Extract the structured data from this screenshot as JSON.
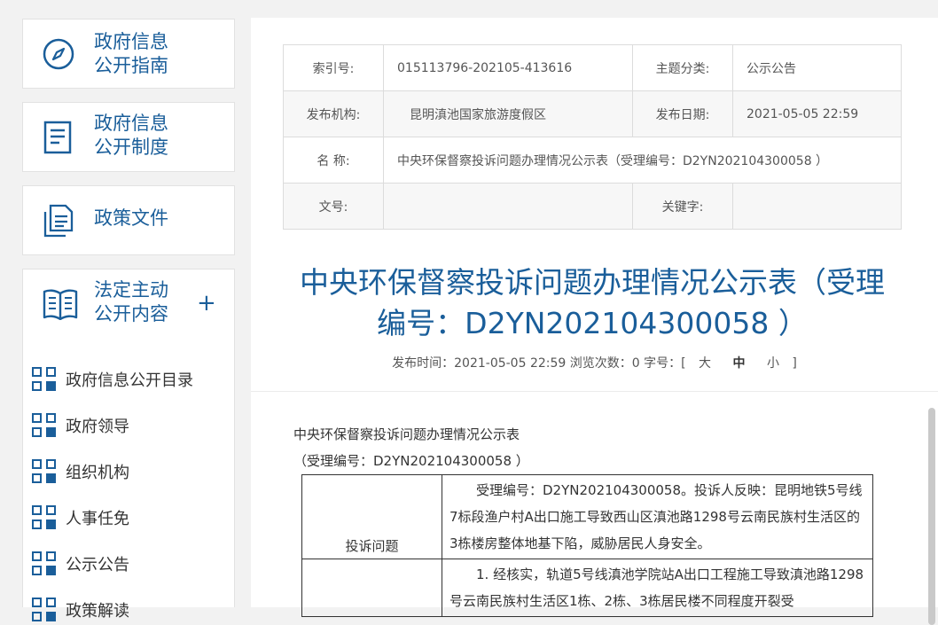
{
  "sidebar": {
    "boxes": [
      {
        "label": "政府信息\n公开指南",
        "icon": "compass-icon"
      },
      {
        "label": "政府信息\n公开制度",
        "icon": "document-icon"
      },
      {
        "label": "政策文件",
        "icon": "files-icon"
      },
      {
        "label": "法定主动\n公开内容",
        "icon": "open-book-icon",
        "expand": "+"
      }
    ],
    "subitems": [
      "政府信息公开目录",
      "政府领导",
      "组织机构",
      "人事任免",
      "公示公告",
      "政策解读"
    ]
  },
  "meta": {
    "index_label": "索引号:",
    "index_value": "015113796-202105-413616",
    "topic_label": "主题分类:",
    "topic_value": "公示公告",
    "org_label": "发布机构:",
    "org_value": "昆明滇池国家旅游度假区",
    "date_label": "发布日期:",
    "date_value": "2021-05-05 22:59",
    "name_label": "名 称:",
    "name_value": "中央环保督察投诉问题办理情况公示表（受理编号：D2YN202104300058 ）",
    "docno_label": "文号:",
    "docno_value": "",
    "keyword_label": "关键字:",
    "keyword_value": ""
  },
  "article": {
    "title": "中央环保督察投诉问题办理情况公示表（受理编号：D2YN202104300058 ）",
    "pub_time": "发布时间：2021-05-05 22:59 浏览次数：0 字号：[",
    "font_large": "大",
    "font_medium": "中",
    "font_small": "小",
    "bracket_close": "]",
    "line1": "中央环保督察投诉问题办理情况公示表",
    "line2": "（受理编号：D2YN202104300058 ）",
    "row1_head": "投诉问题",
    "row1_text": "受理编号：D2YN202104300058。投诉人反映：昆明地铁5号线7标段渔户村A出口施工导致西山区滇池路1298号云南民族村生活区的3栋楼房整体地基下陷，威胁居民人身安全。",
    "row2_text": "1. 经核实，轨道5号线滇池学院站A出口工程施工导致滇池路1298号云南民族村生活区1栋、2栋、3栋居民楼不同程度开裂受"
  }
}
